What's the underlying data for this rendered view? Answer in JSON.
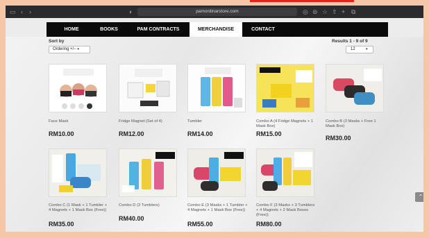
{
  "browser": {
    "url": "pamordinarstore.com",
    "icons": [
      "sidebar-icon",
      "back-icon",
      "forward-icon",
      "shield-icon",
      "lock-icon",
      "share-icon",
      "refresh-icon",
      "reader-icon",
      "bookmark-icon",
      "plus-icon",
      "tabs-icon"
    ]
  },
  "nav": {
    "items": [
      {
        "label": "HOME"
      },
      {
        "label": "BOOKS"
      },
      {
        "label": "PAM CONTRACTS"
      },
      {
        "label": "MERCHANDISE"
      },
      {
        "label": "CONTACT"
      }
    ],
    "active": "MERCHANDISE"
  },
  "toolbar": {
    "sort_label": "Sort by",
    "sort_value": "Ordering +/−",
    "results_text": "Results 1 - 9 of 9",
    "per_page_value": "12"
  },
  "products": [
    {
      "name": "Face Mask",
      "price": "RM10.00",
      "thumb_style": "mask"
    },
    {
      "name": "Fridge Magnet (Set of 4)",
      "price": "RM12.00",
      "thumb_style": "magnet"
    },
    {
      "name": "Tumbler",
      "price": "RM14.00",
      "thumb_style": "tumbler"
    },
    {
      "name": "Combo A (4 Fridge Magnets + 1 Mask Box)",
      "price": "RM15.00",
      "thumb_style": "combo-yellow"
    },
    {
      "name": "Combo B (3 Masks + Free 1 Mask Box)",
      "price": "RM30.00",
      "thumb_style": "combo-mask"
    },
    {
      "name": "Combo C (1 Mask + 1 Tumbler + 4 Magnets + 1 Mask Box (Free))",
      "price": "RM35.00",
      "thumb_style": "combo-c"
    },
    {
      "name": "Combo D (3 Tumblers)",
      "price": "RM40.00",
      "thumb_style": "combo-d"
    },
    {
      "name": "Combo E (3 Masks + 1 Tumbler + 4 Magnets + 1 Mask Box (Free))",
      "price": "RM55.00",
      "thumb_style": "combo-e"
    },
    {
      "name": "Combo F (3 Masks + 3 Tumblers + 4 Magnets + 2 Mask Boxes (Free))",
      "price": "RM80.00",
      "thumb_style": "combo-f"
    }
  ],
  "scroll_top_icon": "chevron-up-icon",
  "colors": {
    "nav_bg": "#0a0a0a",
    "accent_red": "#e0261b",
    "frame": "#f6c7a6"
  }
}
